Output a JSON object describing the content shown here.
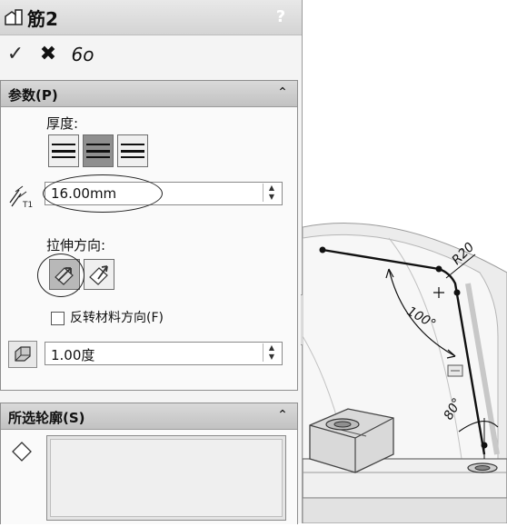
{
  "panel": {
    "title": "筋2",
    "help_glyph": "?",
    "actions": {
      "ok": "✓",
      "cancel": "✖",
      "preview": "6o"
    },
    "parameters": {
      "title": "参数(P)",
      "collapse_glyph": "⌃",
      "thickness_label": "厚度:",
      "thickness_value": "16.00mm",
      "extrusion_label": "拉伸方向:",
      "flip_label": "反转材料方向(F)",
      "flip_checked": false,
      "draft_value": "1.00度"
    },
    "selected_contours": {
      "title": "所选轮廓(S)",
      "collapse_glyph": "⌃"
    }
  },
  "viewport": {
    "dim_r": "R20",
    "dim_angle_1": "100°",
    "dim_angle_2": "80°"
  }
}
